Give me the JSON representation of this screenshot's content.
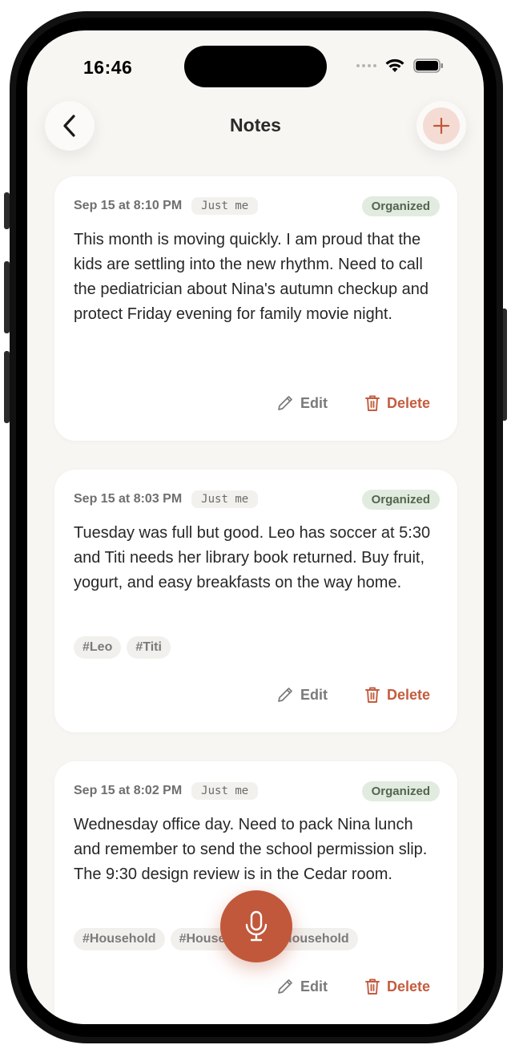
{
  "status_bar": {
    "time": "16:46"
  },
  "header": {
    "title": "Notes"
  },
  "notes": [
    {
      "date": "Sep 15 at 8:10 PM",
      "audience": "Just me",
      "status": "Organized",
      "text": "This month is moving quickly. I am proud that the kids are settling into the new rhythm. Need to call the pediatrician about Nina's autumn checkup and protect Friday evening for family movie night.",
      "tags": [],
      "edit_label": "Edit",
      "delete_label": "Delete"
    },
    {
      "date": "Sep 15 at 8:03 PM",
      "audience": "Just me",
      "status": "Organized",
      "text": "Tuesday was full but good. Leo has soccer at 5:30 and Titi needs her library book returned. Buy fruit, yogurt, and easy breakfasts on the way home.",
      "tags": [
        "#Leo",
        "#Titi"
      ],
      "edit_label": "Edit",
      "delete_label": "Delete"
    },
    {
      "date": "Sep 15 at 8:02 PM",
      "audience": "Just me",
      "status": "Organized",
      "text": "Wednesday office day. Need to pack Nina lunch and remember to send the school permission slip. The 9:30 design review is in the Cedar room.",
      "tags": [
        "#Household",
        "#Household",
        "#Household"
      ],
      "edit_label": "Edit",
      "delete_label": "Delete"
    }
  ],
  "icons": {
    "back": "chevron-left-icon",
    "add": "plus-icon",
    "mic": "microphone-icon",
    "edit": "pencil-icon",
    "delete": "trash-icon"
  },
  "colors": {
    "accent": "#c1583b",
    "background": "#f7f6f3",
    "badge_bg": "#e2ebdf",
    "badge_text": "#52664f"
  }
}
